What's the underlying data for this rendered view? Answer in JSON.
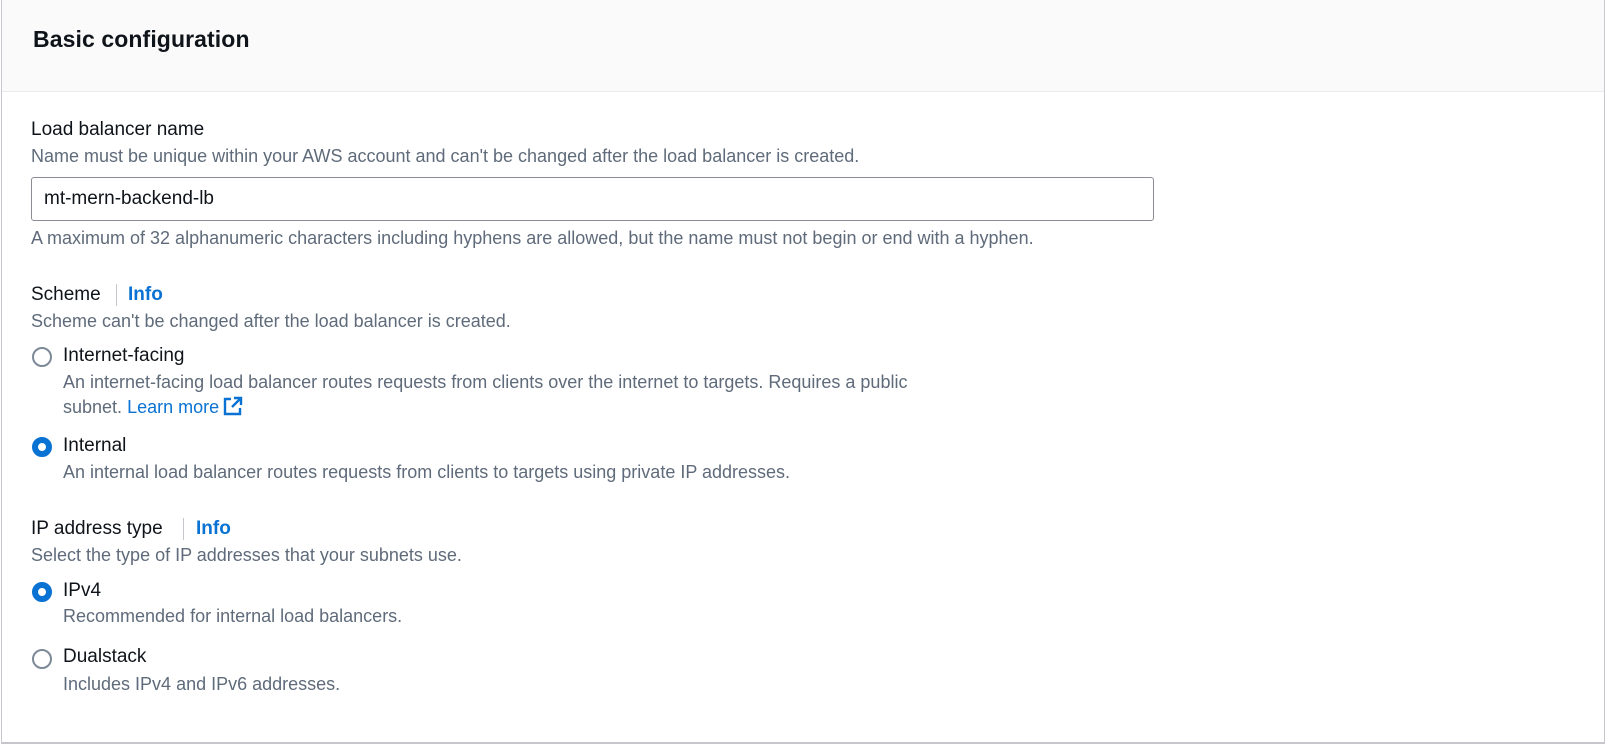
{
  "section": {
    "title": "Basic configuration"
  },
  "lb_name": {
    "label": "Load balancer name",
    "description": "Name must be unique within your AWS account and can't be changed after the load balancer is created.",
    "value": "mt-mern-backend-lb",
    "constraint": "A maximum of 32 alphanumeric characters including hyphens are allowed, but the name must not begin or end with a hyphen."
  },
  "scheme": {
    "label": "Scheme",
    "info": "Info",
    "description": "Scheme can't be changed after the load balancer is created.",
    "options": [
      {
        "label": "Internet-facing",
        "description_line1": "An internet-facing load balancer routes requests from clients over the internet to targets. Requires a public",
        "description_line2": "subnet.",
        "learn_more": "Learn more",
        "learn_more_icon": "external-link-icon",
        "selected": false
      },
      {
        "label": "Internal",
        "description": "An internal load balancer routes requests from clients to targets using private IP addresses.",
        "selected": true
      }
    ]
  },
  "ip_type": {
    "label": "IP address type",
    "info": "Info",
    "description": "Select the type of IP addresses that your subnets use.",
    "options": [
      {
        "label": "IPv4",
        "description": "Recommended for internal load balancers.",
        "selected": true
      },
      {
        "label": "Dualstack",
        "description": "Includes IPv4 and IPv6 addresses.",
        "selected": false
      }
    ]
  },
  "colors": {
    "accent": "#0972d3",
    "text": "#0f141a",
    "muted": "#5f6b7a",
    "border": "#8c8c94"
  }
}
